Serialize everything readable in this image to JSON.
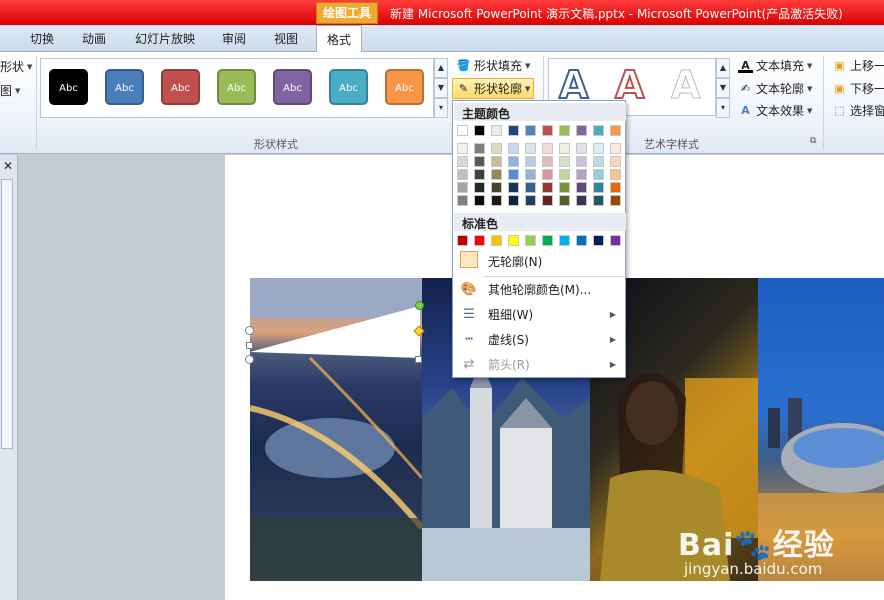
{
  "titlebar": {
    "context_tab": "绘图工具",
    "doc_title": "新建 Microsoft PowerPoint 演示文稿.pptx  -  Microsoft PowerPoint(产品激活失败)"
  },
  "tabs": [
    {
      "label": "切换"
    },
    {
      "label": "动画"
    },
    {
      "label": "幻灯片放映"
    },
    {
      "label": "审阅"
    },
    {
      "label": "视图"
    },
    {
      "label": "格式"
    }
  ],
  "ribbon": {
    "left_cut": [
      "形状",
      "图"
    ],
    "shape_styles": {
      "label": "形状样式",
      "swatches": [
        {
          "text": "Abc",
          "color": "#000000"
        },
        {
          "text": "Abc",
          "color": "#4a7ebb"
        },
        {
          "text": "Abc",
          "color": "#c0504d"
        },
        {
          "text": "Abc",
          "color": "#9bbb59"
        },
        {
          "text": "Abc",
          "color": "#8064a2"
        },
        {
          "text": "Abc",
          "color": "#4bacc6"
        },
        {
          "text": "Abc",
          "color": "#f79646"
        }
      ]
    },
    "shape_fill": "形状填充",
    "shape_outline": "形状轮廓",
    "wordart": {
      "label": "艺术字样式",
      "letter": "A",
      "text_fill": "文本填充",
      "text_outline": "文本轮廓",
      "text_effects": "文本效果"
    },
    "arrange": {
      "bring_forward": "上移一",
      "send_backward": "下移一",
      "selection_pane": "选择窗"
    }
  },
  "dropdown": {
    "theme_colors_header": "主题颜色",
    "theme_top_row": [
      "#ffffff",
      "#000000",
      "#eeece1",
      "#1f497d",
      "#4f81bd",
      "#c0504d",
      "#9bbb59",
      "#8064a2",
      "#4bacc6",
      "#f79646"
    ],
    "theme_shades": [
      [
        "#f2f2f2",
        "#7f7f7f",
        "#ddd9c3",
        "#c6d9f0",
        "#dbe5f1",
        "#f2dcdb",
        "#ebf1dd",
        "#e5e0ec",
        "#dbeef3",
        "#fdeada"
      ],
      [
        "#d8d8d8",
        "#595959",
        "#c4bd97",
        "#8db3e2",
        "#b8cce4",
        "#e5b9b7",
        "#d7e3bc",
        "#ccc1d9",
        "#b7dde8",
        "#fbd5b5"
      ],
      [
        "#bfbfbf",
        "#3f3f3f",
        "#938953",
        "#548dd4",
        "#95b3d7",
        "#d99694",
        "#c3d69b",
        "#b2a2c7",
        "#92cddc",
        "#fac08f"
      ],
      [
        "#a5a5a5",
        "#262626",
        "#494429",
        "#17365d",
        "#366092",
        "#953734",
        "#76923c",
        "#5f497a",
        "#31859b",
        "#e36c09"
      ],
      [
        "#7f7f7f",
        "#0c0c0c",
        "#1d1b10",
        "#0f243e",
        "#244061",
        "#632423",
        "#4f6128",
        "#3f3151",
        "#205867",
        "#974806"
      ]
    ],
    "standard_colors_header": "标准色",
    "standard_colors": [
      "#c00000",
      "#ff0000",
      "#ffc000",
      "#ffff00",
      "#92d050",
      "#00b050",
      "#00b0f0",
      "#0070c0",
      "#002060",
      "#7030a0"
    ],
    "no_outline": "无轮廓(N)",
    "more_colors": "其他轮廓颜色(M)...",
    "weight": "粗细(W)",
    "dashes": "虚线(S)",
    "arrows": "箭头(R)"
  },
  "watermark": {
    "logo": "Bai🐾经验",
    "site": "jingyan.baidu.com"
  }
}
